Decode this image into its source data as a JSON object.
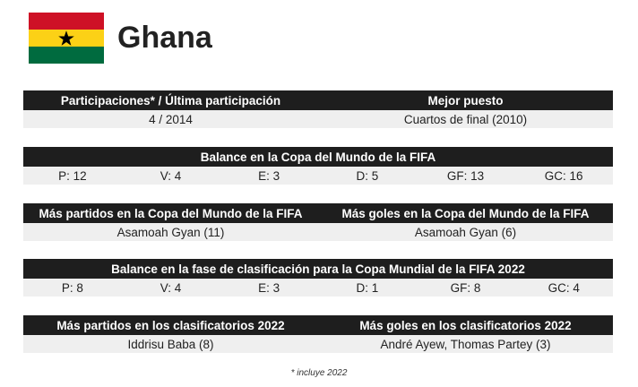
{
  "team": {
    "name": "Ghana",
    "flag_colors": {
      "top": "#ce1126",
      "middle": "#fcd116",
      "bottom": "#006b3f",
      "star": "#000000"
    }
  },
  "participation": {
    "left_header": "Participaciones* / Última participación",
    "left_value": "4 / 2014",
    "right_header": "Mejor puesto",
    "right_value": "Cuartos de final (2010)"
  },
  "world_cup_balance": {
    "header": "Balance en la Copa del Mundo de la FIFA",
    "stats": [
      "P: 12",
      "V: 4",
      "E: 3",
      "D: 5",
      "GF: 13",
      "GC: 16"
    ]
  },
  "world_cup_records": {
    "left_header": "Más partidos en la Copa del Mundo de la FIFA",
    "left_value": "Asamoah Gyan (11)",
    "right_header": "Más goles en la Copa del Mundo de la FIFA",
    "right_value": "Asamoah Gyan (6)"
  },
  "qualifying_balance": {
    "header": "Balance en la fase de clasificación para la Copa Mundial de la FIFA 2022",
    "stats": [
      "P: 8",
      "V: 4",
      "E: 3",
      "D: 1",
      "GF: 8",
      "GC: 4"
    ]
  },
  "qualifying_records": {
    "left_header": "Más partidos en los clasificatorios 2022",
    "left_value": "Iddrisu Baba (8)",
    "right_header": "Más goles en los clasificatorios 2022",
    "right_value": "André Ayew, Thomas Partey (3)"
  },
  "footnote": "* incluye 2022"
}
